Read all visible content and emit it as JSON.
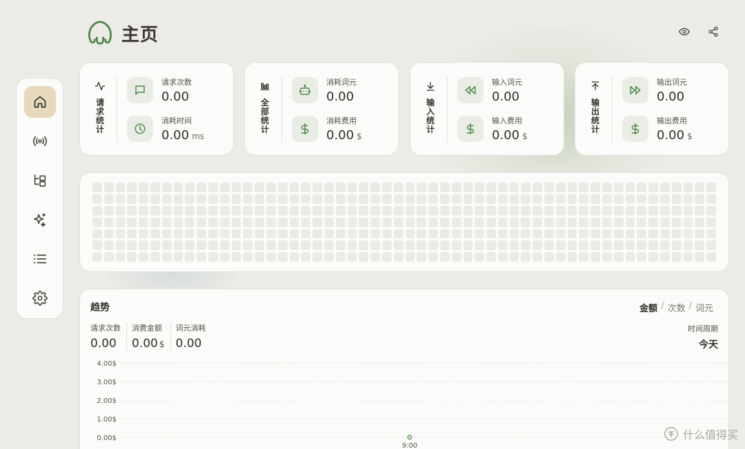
{
  "header": {
    "title": "主页",
    "actions": [
      "eye-icon",
      "share-icon"
    ]
  },
  "sidebar": {
    "items": [
      {
        "name": "home",
        "icon": "home-icon",
        "active": true
      },
      {
        "name": "broadcast",
        "icon": "broadcast-icon",
        "active": false
      },
      {
        "name": "structure",
        "icon": "tree-icon",
        "active": false
      },
      {
        "name": "sparkle",
        "icon": "sparkle-icon",
        "active": false
      },
      {
        "name": "list",
        "icon": "list-icon",
        "active": false
      },
      {
        "name": "settings",
        "icon": "gear-icon",
        "active": false
      }
    ]
  },
  "cards": [
    {
      "title": "请求统计",
      "icon": "activity-icon",
      "metrics": [
        {
          "label": "请求次数",
          "value": "0.00",
          "unit": "",
          "icon": "chat-icon"
        },
        {
          "label": "消耗时间",
          "value": "0.00",
          "unit": "ms",
          "icon": "clock-icon"
        }
      ]
    },
    {
      "title": "全部统计",
      "icon": "bar-chart-icon",
      "metrics": [
        {
          "label": "消耗词元",
          "value": "0.00",
          "unit": "",
          "icon": "robot-icon"
        },
        {
          "label": "消耗费用",
          "value": "0.00",
          "unit": "$",
          "icon": "dollar-icon"
        }
      ]
    },
    {
      "title": "输入统计",
      "icon": "arrow-down-icon",
      "metrics": [
        {
          "label": "输入词元",
          "value": "0.00",
          "unit": "",
          "icon": "rewind-icon"
        },
        {
          "label": "输入费用",
          "value": "0.00",
          "unit": "$",
          "icon": "dollar-icon"
        }
      ]
    },
    {
      "title": "输出统计",
      "icon": "arrow-up-icon",
      "metrics": [
        {
          "label": "输出词元",
          "value": "0.00",
          "unit": "",
          "icon": "fast-forward-icon"
        },
        {
          "label": "输出费用",
          "value": "0.00",
          "unit": "$",
          "icon": "dollar-icon"
        }
      ]
    }
  ],
  "trend": {
    "title": "趋势",
    "toggle": [
      "金额",
      "次数",
      "词元"
    ],
    "toggle_active": "金额",
    "summary": [
      {
        "label": "请求次数",
        "value": "0.00",
        "unit": ""
      },
      {
        "label": "消费金额",
        "value": "0.00",
        "unit": "$"
      },
      {
        "label": "词元消耗",
        "value": "0.00",
        "unit": ""
      }
    ],
    "period_label": "时间周期",
    "period_value": "今天"
  },
  "chart_data": {
    "type": "line",
    "x": [
      "9:00"
    ],
    "series": [
      {
        "values": [
          0
        ]
      }
    ],
    "yticks": [
      "0.00$",
      "1.00$",
      "2.00$",
      "3.00$",
      "4.00$"
    ],
    "ylim": [
      0,
      4
    ],
    "grid": true
  },
  "colors": {
    "accent": "#4f8a4a",
    "active_nav": "#e8d9bd",
    "icon_bg": "#e9ede5"
  },
  "watermark": "什么值得买"
}
